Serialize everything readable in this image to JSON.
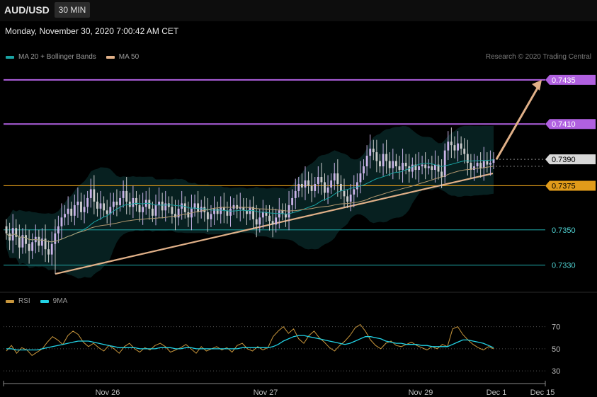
{
  "header": {
    "symbol": "AUD/USD",
    "timeframe": "30 MIN",
    "timestamp": "Monday, November 30, 2020 7:00:42 AM CET",
    "research": "Research © 2020 Trading Central"
  },
  "legend": {
    "main": [
      {
        "label": "MA 20 + Bollinger Bands",
        "color": "#1aa3a3"
      },
      {
        "label": "MA 50",
        "color": "#e0b088"
      }
    ],
    "rsi": [
      {
        "label": "RSI",
        "color": "#c8963c"
      },
      {
        "label": "9MA",
        "color": "#22d3e6"
      }
    ]
  },
  "colors": {
    "resistance": "#b060e0",
    "pivot": "#e09b1a",
    "support": "#1a8a8a",
    "trend": "#e0b088",
    "bull": "#c9b3e8",
    "bear": "#cccccc"
  },
  "chart_data": [
    {
      "type": "candlestick",
      "title": "AUD/USD 30 MIN",
      "ylim": [
        0.7315,
        0.7445
      ],
      "levels": [
        {
          "value": 0.7435,
          "label": "0.7435",
          "role": "resistance"
        },
        {
          "value": 0.741,
          "label": "0.7410",
          "role": "resistance"
        },
        {
          "value": 0.739,
          "label": "0.7390",
          "role": "current"
        },
        {
          "value": 0.7375,
          "label": "0.7375",
          "role": "pivot"
        },
        {
          "value": 0.735,
          "label": "0.7350",
          "role": "support"
        },
        {
          "value": 0.733,
          "label": "0.7330",
          "role": "support"
        }
      ],
      "x_ticks": [
        "Nov 26",
        "Nov 27",
        "Nov 29",
        "Dec 1",
        "Dec 15"
      ],
      "close": [
        0.7348,
        0.7344,
        0.7351,
        0.7346,
        0.734,
        0.7347,
        0.7342,
        0.7338,
        0.7343,
        0.7346,
        0.7341,
        0.7345,
        0.7339,
        0.7336,
        0.7342,
        0.7348,
        0.7352,
        0.7357,
        0.7359,
        0.7362,
        0.7358,
        0.7364,
        0.7366,
        0.736,
        0.7363,
        0.7368,
        0.7373,
        0.7366,
        0.7362,
        0.7365,
        0.7361,
        0.7359,
        0.7363,
        0.7366,
        0.7364,
        0.7368,
        0.7372,
        0.7366,
        0.7363,
        0.7368,
        0.7364,
        0.736,
        0.7363,
        0.7367,
        0.7362,
        0.7358,
        0.7364,
        0.7366,
        0.7361,
        0.7365,
        0.7363,
        0.7359,
        0.7357,
        0.7362,
        0.7365,
        0.736,
        0.7357,
        0.7362,
        0.7365,
        0.736,
        0.7363,
        0.736,
        0.7356,
        0.7359,
        0.7362,
        0.7359,
        0.7363,
        0.7361,
        0.7358,
        0.7362,
        0.7364,
        0.7362,
        0.7363,
        0.7361,
        0.7359,
        0.7363,
        0.7356,
        0.7353,
        0.7357,
        0.736,
        0.7358,
        0.7355,
        0.7353,
        0.7357,
        0.7361,
        0.7359,
        0.7357,
        0.7364,
        0.7368,
        0.7372,
        0.7376,
        0.7374,
        0.7378,
        0.7375,
        0.7372,
        0.7376,
        0.738,
        0.7377,
        0.7371,
        0.7374,
        0.7378,
        0.7382,
        0.7376,
        0.7372,
        0.7369,
        0.7366,
        0.737,
        0.7373,
        0.7377,
        0.7382,
        0.7386,
        0.7392,
        0.7396,
        0.7394,
        0.7389,
        0.7386,
        0.7393,
        0.7389,
        0.7385,
        0.7389,
        0.7386,
        0.7384,
        0.7388,
        0.7386,
        0.7383,
        0.7387,
        0.7384,
        0.7386,
        0.7387,
        0.7385,
        0.7386,
        0.7384,
        0.7387,
        0.7383,
        0.738,
        0.7395,
        0.74,
        0.7398,
        0.7395,
        0.7399,
        0.7396,
        0.7393,
        0.7388,
        0.7384,
        0.7386,
        0.7388,
        0.7385,
        0.7389,
        0.7387,
        0.7388,
        0.739
      ],
      "forecast": {
        "from": 0.739,
        "to": 0.7435
      },
      "trendline": {
        "start": 0.7325,
        "end": 0.7382
      }
    },
    {
      "type": "line",
      "title": "RSI",
      "ylim": [
        25,
        80
      ],
      "y_ticks": [
        70,
        50,
        30
      ],
      "series": [
        {
          "name": "RSI",
          "values": [
            48,
            53,
            46,
            51,
            49,
            44,
            47,
            50,
            56,
            61,
            58,
            54,
            62,
            66,
            63,
            56,
            52,
            55,
            51,
            48,
            53,
            50,
            46,
            52,
            55,
            50,
            47,
            51,
            49,
            53,
            55,
            52,
            47,
            49,
            51,
            54,
            50,
            46,
            52,
            48,
            50,
            52,
            49,
            51,
            47,
            53,
            55,
            50,
            48,
            52,
            49,
            51,
            61,
            66,
            70,
            64,
            68,
            59,
            55,
            62,
            66,
            60,
            56,
            51,
            48,
            53,
            57,
            62,
            69,
            72,
            66,
            58,
            53,
            50,
            55,
            57,
            53,
            52,
            54,
            56,
            53,
            51,
            49,
            52,
            50,
            54,
            52,
            68,
            70,
            63,
            58,
            54,
            51,
            49,
            52,
            50
          ]
        },
        {
          "name": "9MA",
          "values": [
            50,
            50,
            49,
            49,
            49,
            49,
            49,
            50,
            51,
            52,
            53,
            54,
            55,
            56,
            57,
            57,
            57,
            56,
            55,
            54,
            53,
            52,
            51,
            51,
            51,
            51,
            50,
            50,
            50,
            50,
            51,
            51,
            51,
            50,
            50,
            51,
            51,
            50,
            50,
            50,
            50,
            50,
            50,
            50,
            50,
            50,
            51,
            51,
            51,
            51,
            51,
            51,
            52,
            54,
            57,
            59,
            61,
            62,
            62,
            61,
            60,
            59,
            58,
            57,
            56,
            55,
            54,
            55,
            57,
            59,
            61,
            61,
            60,
            59,
            57,
            56,
            55,
            55,
            54,
            54,
            54,
            53,
            53,
            52,
            52,
            52,
            52,
            54,
            56,
            58,
            58,
            57,
            56,
            55,
            53,
            51
          ]
        }
      ]
    }
  ]
}
